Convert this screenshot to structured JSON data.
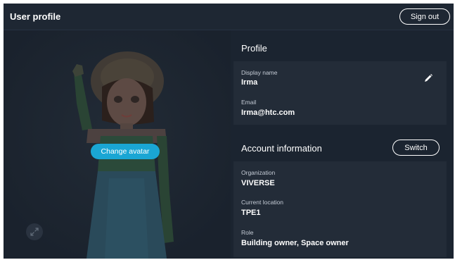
{
  "header": {
    "title": "User profile",
    "sign_out_label": "Sign out"
  },
  "avatar_panel": {
    "change_avatar_label": "Change avatar",
    "expand_icon": "expand-arrows-icon"
  },
  "profile": {
    "section_title": "Profile",
    "display_name_label": "Display name",
    "display_name_value": "Irma",
    "email_label": "Email",
    "email_value": "Irma@htc.com",
    "edit_icon": "pencil-icon"
  },
  "account": {
    "section_title": "Account information",
    "switch_label": "Switch",
    "organization_label": "Organization",
    "organization_value": "VIVERSE",
    "location_label": "Current location",
    "location_value": "TPE1",
    "role_label": "Role",
    "role_value": "Building owner, Space owner"
  },
  "colors": {
    "background": "#1b2430",
    "card": "#232c38",
    "accent": "#1aa6d4",
    "text": "#ffffff"
  }
}
